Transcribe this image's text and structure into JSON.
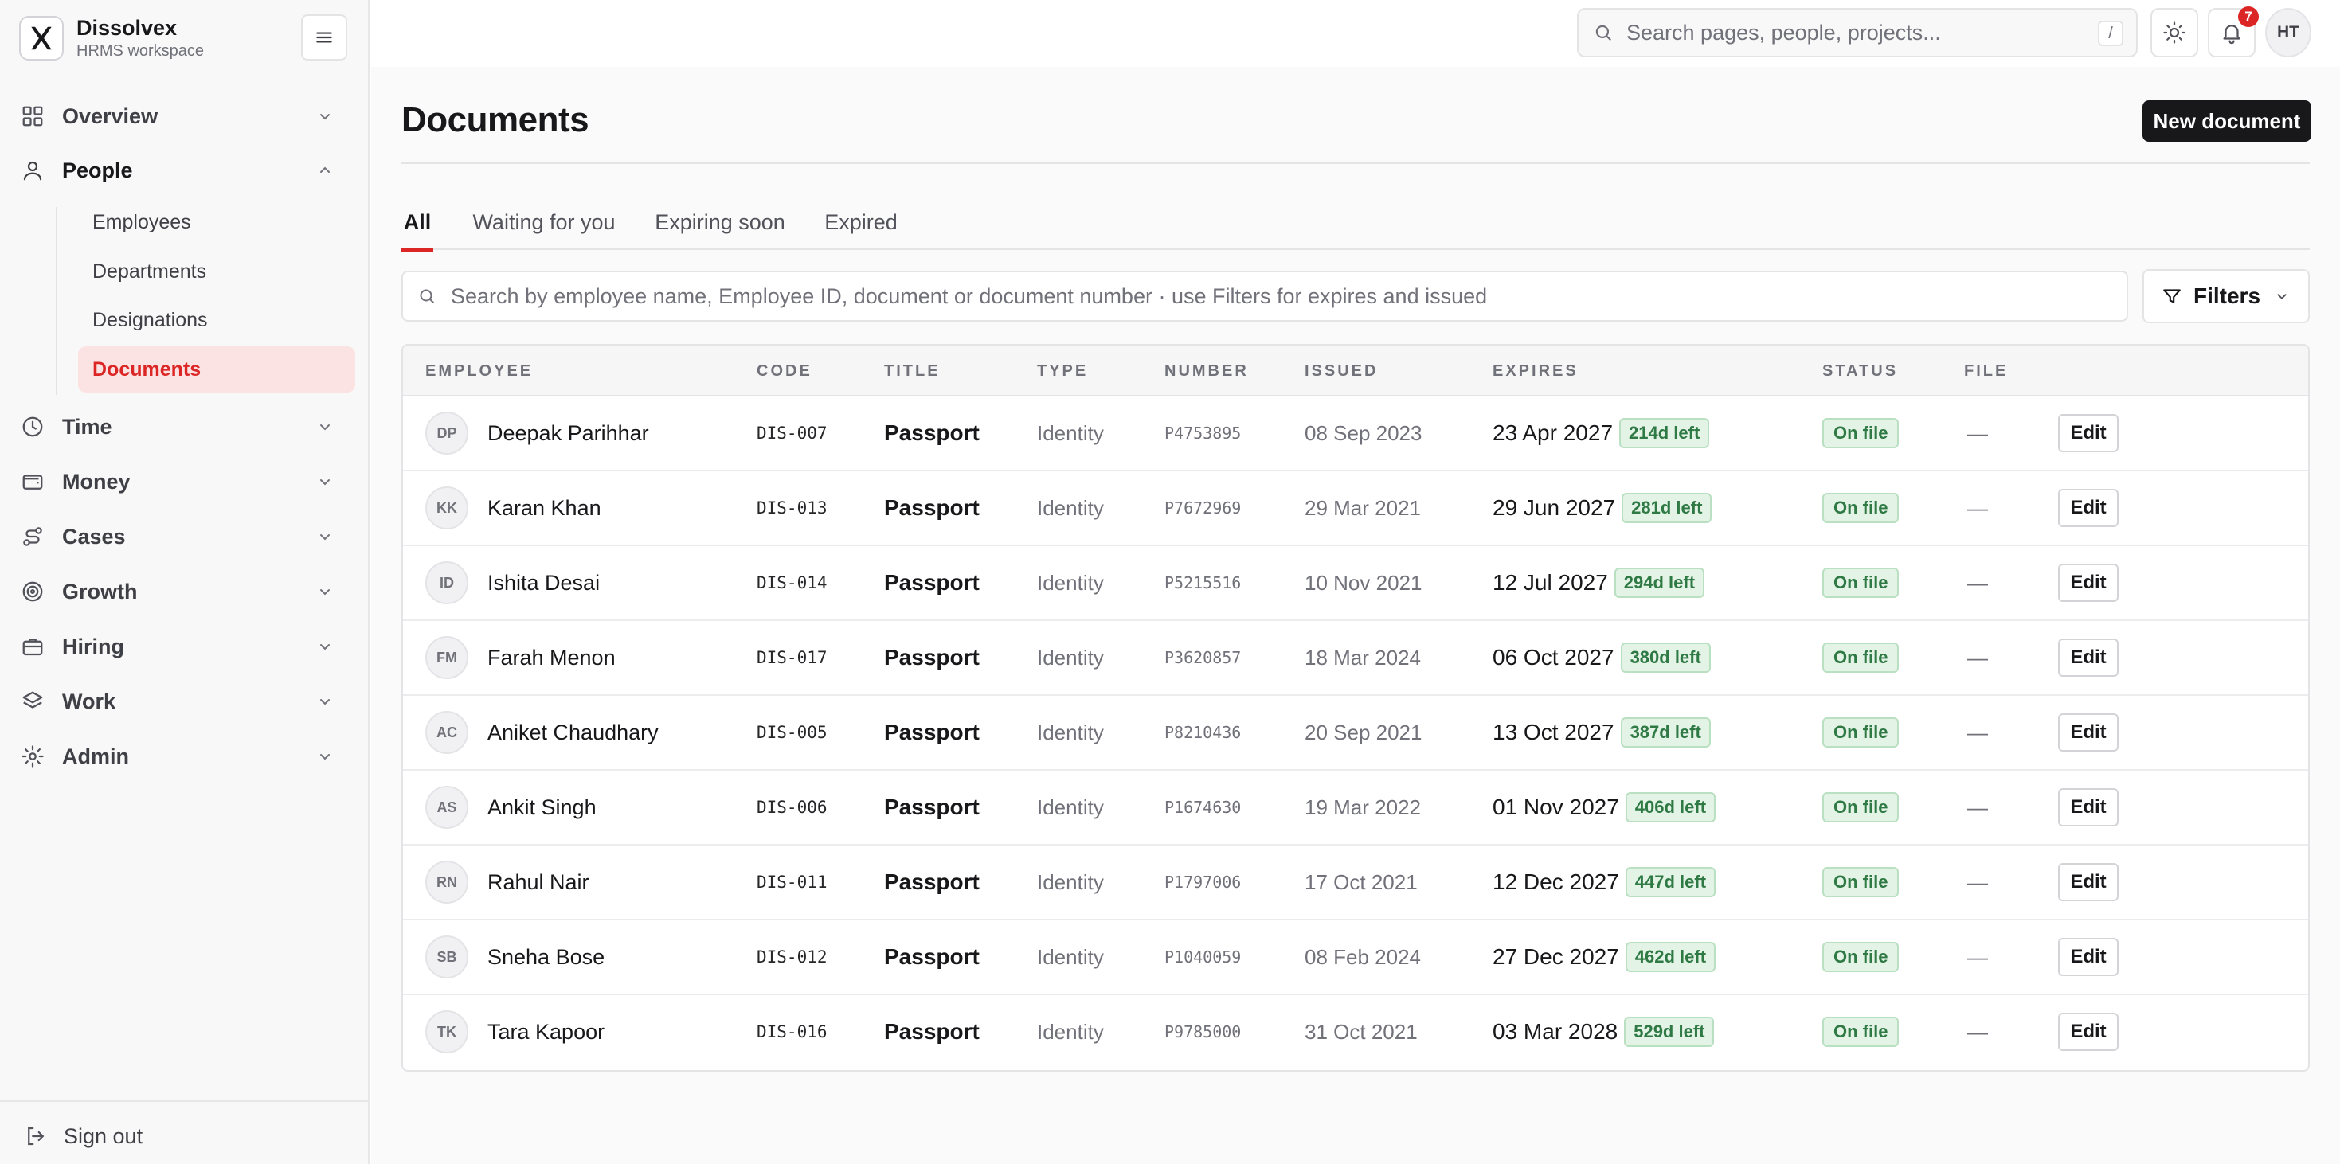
{
  "brand": {
    "name": "Dissolvex",
    "subtitle": "HRMS workspace",
    "logo_icon": "x-logo-icon"
  },
  "sidebar": {
    "nav": [
      {
        "label": "Overview",
        "icon": "grid-icon",
        "expanded": false
      },
      {
        "label": "People",
        "icon": "user-icon",
        "expanded": true
      },
      {
        "label": "Time",
        "icon": "clock-icon",
        "expanded": false
      },
      {
        "label": "Money",
        "icon": "wallet-icon",
        "expanded": false
      },
      {
        "label": "Cases",
        "icon": "route-icon",
        "expanded": false
      },
      {
        "label": "Growth",
        "icon": "target-icon",
        "expanded": false
      },
      {
        "label": "Hiring",
        "icon": "briefcase-icon",
        "expanded": false
      },
      {
        "label": "Work",
        "icon": "layers-icon",
        "expanded": false
      },
      {
        "label": "Admin",
        "icon": "gear-icon",
        "expanded": false
      }
    ],
    "people_items": [
      "Employees",
      "Departments",
      "Designations",
      "Documents"
    ],
    "active_item": "Documents",
    "sign_out": "Sign out"
  },
  "topbar": {
    "search_placeholder": "Search pages, people, projects...",
    "search_shortcut": "/",
    "notification_count": "7",
    "user_initials": "HT"
  },
  "page": {
    "title": "Documents",
    "new_button": "New document",
    "tabs": [
      "All",
      "Waiting for you",
      "Expiring soon",
      "Expired"
    ],
    "active_tab": "All",
    "search_placeholder": "Search by employee name, Employee ID, document or document number · use Filters for expires and issued",
    "filters_label": "Filters"
  },
  "table": {
    "columns": [
      "EMPLOYEE",
      "CODE",
      "TITLE",
      "TYPE",
      "NUMBER",
      "ISSUED",
      "EXPIRES",
      "STATUS",
      "FILE"
    ],
    "edit_label": "Edit",
    "rows": [
      {
        "initials": "DP",
        "name": "Deepak Parihhar",
        "code": "DIS-007",
        "title": "Passport",
        "type": "Identity",
        "number": "P4753895",
        "issued": "08 Sep 2023",
        "expires": "23 Apr 2027",
        "left": "214d left",
        "status": "On file",
        "file": "—"
      },
      {
        "initials": "KK",
        "name": "Karan Khan",
        "code": "DIS-013",
        "title": "Passport",
        "type": "Identity",
        "number": "P7672969",
        "issued": "29 Mar 2021",
        "expires": "29 Jun 2027",
        "left": "281d left",
        "status": "On file",
        "file": "—"
      },
      {
        "initials": "ID",
        "name": "Ishita Desai",
        "code": "DIS-014",
        "title": "Passport",
        "type": "Identity",
        "number": "P5215516",
        "issued": "10 Nov 2021",
        "expires": "12 Jul 2027",
        "left": "294d left",
        "status": "On file",
        "file": "—"
      },
      {
        "initials": "FM",
        "name": "Farah Menon",
        "code": "DIS-017",
        "title": "Passport",
        "type": "Identity",
        "number": "P3620857",
        "issued": "18 Mar 2024",
        "expires": "06 Oct 2027",
        "left": "380d left",
        "status": "On file",
        "file": "—"
      },
      {
        "initials": "AC",
        "name": "Aniket Chaudhary",
        "code": "DIS-005",
        "title": "Passport",
        "type": "Identity",
        "number": "P8210436",
        "issued": "20 Sep 2021",
        "expires": "13 Oct 2027",
        "left": "387d left",
        "status": "On file",
        "file": "—"
      },
      {
        "initials": "AS",
        "name": "Ankit Singh",
        "code": "DIS-006",
        "title": "Passport",
        "type": "Identity",
        "number": "P1674630",
        "issued": "19 Mar 2022",
        "expires": "01 Nov 2027",
        "left": "406d left",
        "status": "On file",
        "file": "—"
      },
      {
        "initials": "RN",
        "name": "Rahul Nair",
        "code": "DIS-011",
        "title": "Passport",
        "type": "Identity",
        "number": "P1797006",
        "issued": "17 Oct 2021",
        "expires": "12 Dec 2027",
        "left": "447d left",
        "status": "On file",
        "file": "—"
      },
      {
        "initials": "SB",
        "name": "Sneha Bose",
        "code": "DIS-012",
        "title": "Passport",
        "type": "Identity",
        "number": "P1040059",
        "issued": "08 Feb 2024",
        "expires": "27 Dec 2027",
        "left": "462d left",
        "status": "On file",
        "file": "—"
      },
      {
        "initials": "TK",
        "name": "Tara Kapoor",
        "code": "DIS-016",
        "title": "Passport",
        "type": "Identity",
        "number": "P9785000",
        "issued": "31 Oct 2021",
        "expires": "03 Mar 2028",
        "left": "529d left",
        "status": "On file",
        "file": "—"
      }
    ]
  },
  "colors": {
    "accent": "#dc2626",
    "active_bg": "#fce3e3",
    "success_bg": "#e3f3e6",
    "success_text": "#2f7a44",
    "dark_button": "#18181b"
  }
}
